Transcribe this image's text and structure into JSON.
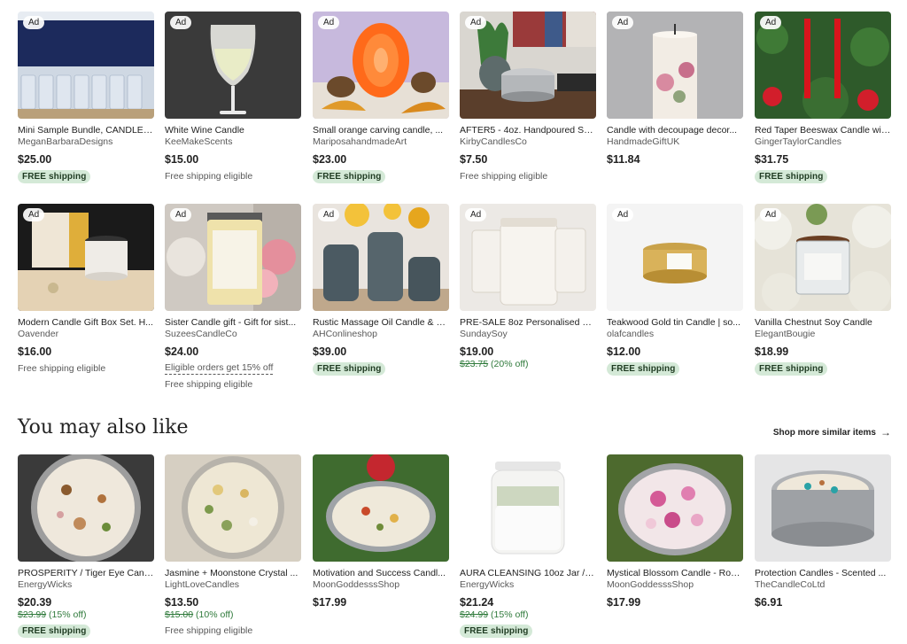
{
  "row1": [
    {
      "title": "Mini Sample Bundle, CANDLE, ...",
      "shop": "MeganBarbaraDesigns",
      "price": "$25.00",
      "ad": "Ad",
      "shipping": "FREE shipping",
      "shipping_type": "pill"
    },
    {
      "title": "White Wine Candle",
      "shop": "KeeMakeScents",
      "price": "$15.00",
      "ad": "Ad",
      "shipping": "Free shipping eligible",
      "shipping_type": "text"
    },
    {
      "title": "Small orange carving candle, ...",
      "shop": "MariposahandmadeArt",
      "price": "$23.00",
      "ad": "Ad",
      "shipping": "FREE shipping",
      "shipping_type": "pill"
    },
    {
      "title": "AFTER5 - 4oz. Handpoured Sc...",
      "shop": "KirbyCandlesCo",
      "price": "$7.50",
      "ad": "Ad",
      "shipping": "Free shipping eligible",
      "shipping_type": "text"
    },
    {
      "title": "Candle with decoupage decor...",
      "shop": "HandmadeGiftUK",
      "price": "$11.84",
      "ad": "Ad",
      "shipping": "",
      "shipping_type": "none"
    },
    {
      "title": "Red Taper Beeswax Candle wit...",
      "shop": "GingerTaylorCandles",
      "price": "$31.75",
      "ad": "Ad",
      "shipping": "FREE shipping",
      "shipping_type": "pill"
    }
  ],
  "row2": [
    {
      "title": "Modern Candle Gift Box Set. H...",
      "shop": "Oavender",
      "price": "$16.00",
      "ad": "Ad",
      "shipping": "Free shipping eligible",
      "shipping_type": "text"
    },
    {
      "title": "Sister Candle gift - Gift for sist...",
      "shop": "SuzeesCandleCo",
      "price": "$24.00",
      "ad": "Ad",
      "eligible_orders": "Eligible orders get 15% off",
      "shipping": "Free shipping eligible",
      "shipping_type": "text"
    },
    {
      "title": "Rustic Massage Oil Candle & V...",
      "shop": "AHConlineshop",
      "price": "$39.00",
      "ad": "Ad",
      "shipping": "FREE shipping",
      "shipping_type": "pill"
    },
    {
      "title": "PRE-SALE 8oz Personalised Na...",
      "shop": "SundaySoy",
      "price": "$19.00",
      "ad": "Ad",
      "original_price": "$23.75",
      "discount": "(20% off)",
      "shipping": "",
      "shipping_type": "none"
    },
    {
      "title": "Teakwood Gold tin Candle | so...",
      "shop": "olafcandles",
      "price": "$12.00",
      "ad": "Ad",
      "shipping": "FREE shipping",
      "shipping_type": "pill"
    },
    {
      "title": "Vanilla Chestnut Soy Candle",
      "shop": "ElegantBougie",
      "price": "$18.99",
      "ad": "Ad",
      "shipping": "FREE shipping",
      "shipping_type": "pill"
    }
  ],
  "recommendations": {
    "heading": "You may also like",
    "shop_more": "Shop more similar items",
    "items": [
      {
        "title": "PROSPERITY / Tiger Eye Candl...",
        "shop": "EnergyWicks",
        "price": "$20.39",
        "original_price": "$23.99",
        "discount": "(15% off)",
        "shipping": "FREE shipping",
        "shipping_type": "pill"
      },
      {
        "title": "Jasmine + Moonstone Crystal ...",
        "shop": "LightLoveCandles",
        "price": "$13.50",
        "original_price": "$15.00",
        "discount": "(10% off)",
        "shipping": "Free shipping eligible",
        "shipping_type": "text"
      },
      {
        "title": "Motivation and Success Candl...",
        "shop": "MoonGoddesssShop",
        "price": "$17.99",
        "shipping": "",
        "shipping_type": "none"
      },
      {
        "title": "AURA CLEANSING 10oz Jar / S...",
        "shop": "EnergyWicks",
        "price": "$21.24",
        "original_price": "$24.99",
        "discount": "(15% off)",
        "shipping": "FREE shipping",
        "shipping_type": "pill"
      },
      {
        "title": "Mystical Blossom Candle - Ros...",
        "shop": "MoonGoddesssShop",
        "price": "$17.99",
        "shipping": "",
        "shipping_type": "none"
      },
      {
        "title": "Protection Candles - Scented ...",
        "shop": "TheCandleCoLtd",
        "price": "$6.91",
        "shipping": "",
        "shipping_type": "none"
      }
    ]
  },
  "colors": {
    "pill_bg": "#d4e9d7",
    "discount_green": "#2f7a3b",
    "text": "#222222",
    "muted": "#595959"
  }
}
